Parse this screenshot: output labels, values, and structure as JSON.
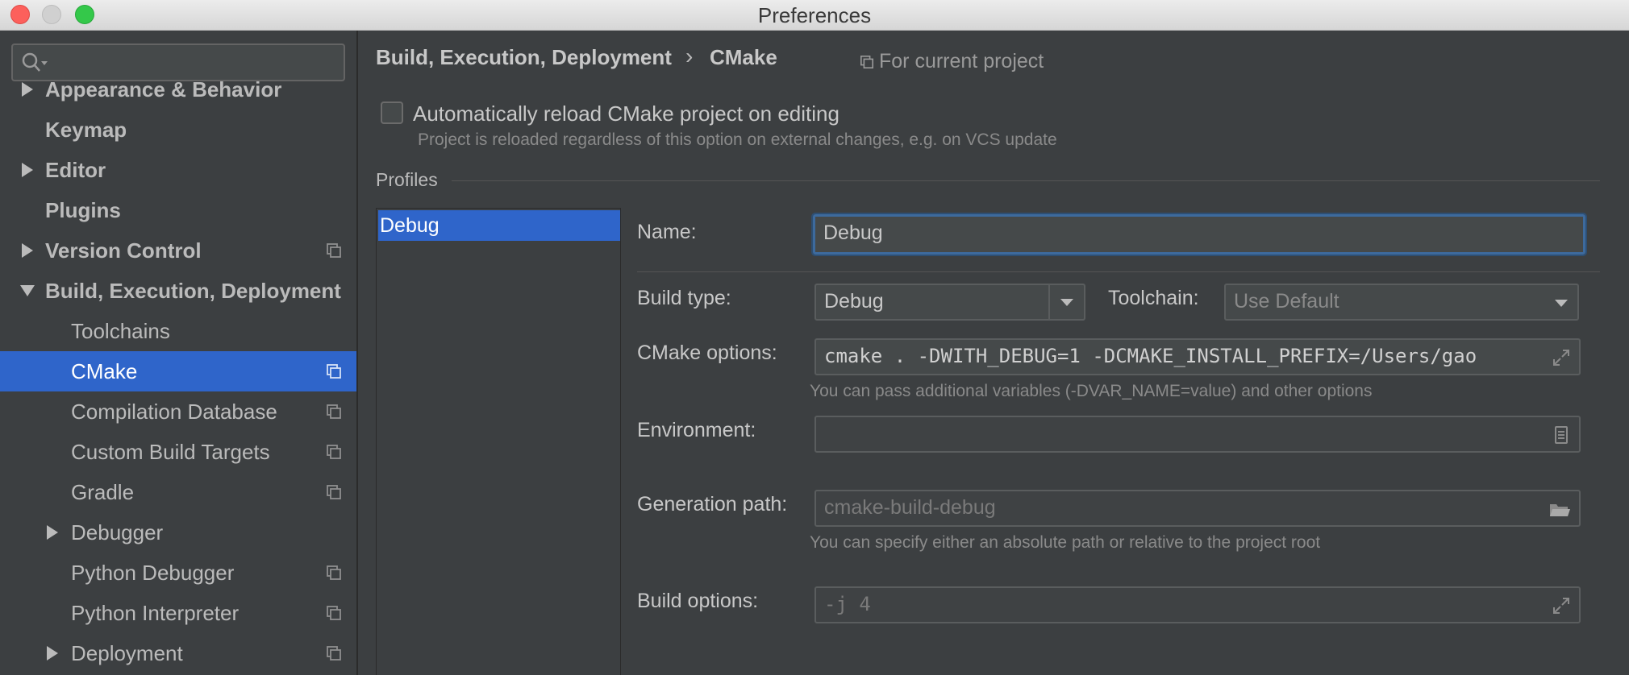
{
  "window": {
    "title": "Preferences"
  },
  "sidebar": {
    "search_placeholder": "",
    "items": [
      {
        "label": "Appearance & Behavior"
      },
      {
        "label": "Keymap"
      },
      {
        "label": "Editor"
      },
      {
        "label": "Plugins"
      },
      {
        "label": "Version Control"
      },
      {
        "label": "Build, Execution, Deployment"
      },
      {
        "label": "Toolchains"
      },
      {
        "label": "CMake"
      },
      {
        "label": "Compilation Database"
      },
      {
        "label": "Custom Build Targets"
      },
      {
        "label": "Gradle"
      },
      {
        "label": "Debugger"
      },
      {
        "label": "Python Debugger"
      },
      {
        "label": "Python Interpreter"
      },
      {
        "label": "Deployment"
      }
    ]
  },
  "header": {
    "breadcrumb_parent": "Build, Execution, Deployment",
    "breadcrumb_separator": "›",
    "breadcrumb_current": "CMake",
    "scope": "For current project"
  },
  "reload": {
    "label": "Automatically reload CMake project on editing",
    "checked": false,
    "hint": "Project is reloaded regardless of this option on external changes, e.g. on VCS update"
  },
  "profiles": {
    "title": "Profiles",
    "list": [
      "Debug"
    ],
    "selected": "Debug",
    "form": {
      "name_label": "Name:",
      "name_value": "Debug",
      "build_type_label": "Build type:",
      "build_type_value": "Debug",
      "toolchain_label": "Toolchain:",
      "toolchain_value": "Use Default",
      "cmake_options_label": "CMake options:",
      "cmake_options_value": "cmake . -DWITH_DEBUG=1 -DCMAKE_INSTALL_PREFIX=/Users/gao",
      "cmake_options_hint": "You can pass additional variables (-DVAR_NAME=value) and other options",
      "environment_label": "Environment:",
      "environment_value": "",
      "generation_path_label": "Generation path:",
      "generation_path_value": "cmake-build-debug",
      "generation_path_hint": "You can specify either an absolute path or relative to the project root",
      "build_options_label": "Build options:",
      "build_options_value": "-j 4"
    }
  },
  "colors": {
    "accent": "#2f65ca",
    "background": "#3c3f41",
    "focus": "#3d6a9d"
  }
}
